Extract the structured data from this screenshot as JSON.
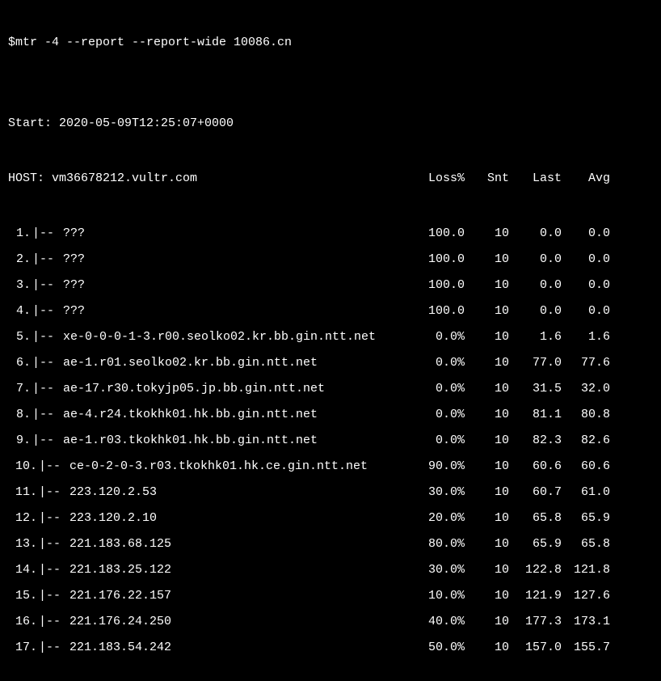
{
  "command": "$mtr -4 --report --report-wide 10086.cn",
  "start_line": "Start: 2020-05-09T12:25:07+0000",
  "host_line": "HOST: vm36678212.vultr.com",
  "headers": {
    "loss": "Loss%",
    "snt": "Snt",
    "last": "Last",
    "avg": "Avg"
  },
  "hops": [
    {
      "num": "1.",
      "tree": "|--",
      "host": "???",
      "loss": "100.0",
      "snt": "10",
      "last": "0.0",
      "avg": "0.0"
    },
    {
      "num": "2.",
      "tree": "|--",
      "host": "???",
      "loss": "100.0",
      "snt": "10",
      "last": "0.0",
      "avg": "0.0"
    },
    {
      "num": "3.",
      "tree": "|--",
      "host": "???",
      "loss": "100.0",
      "snt": "10",
      "last": "0.0",
      "avg": "0.0"
    },
    {
      "num": "4.",
      "tree": "|--",
      "host": "???",
      "loss": "100.0",
      "snt": "10",
      "last": "0.0",
      "avg": "0.0"
    },
    {
      "num": "5.",
      "tree": "|--",
      "host": "xe-0-0-0-1-3.r00.seolko02.kr.bb.gin.ntt.net",
      "loss": "0.0%",
      "snt": "10",
      "last": "1.6",
      "avg": "1.6"
    },
    {
      "num": "6.",
      "tree": "|--",
      "host": "ae-1.r01.seolko02.kr.bb.gin.ntt.net",
      "loss": "0.0%",
      "snt": "10",
      "last": "77.0",
      "avg": "77.6"
    },
    {
      "num": "7.",
      "tree": "|--",
      "host": "ae-17.r30.tokyjp05.jp.bb.gin.ntt.net",
      "loss": "0.0%",
      "snt": "10",
      "last": "31.5",
      "avg": "32.0"
    },
    {
      "num": "8.",
      "tree": "|--",
      "host": "ae-4.r24.tkokhk01.hk.bb.gin.ntt.net",
      "loss": "0.0%",
      "snt": "10",
      "last": "81.1",
      "avg": "80.8"
    },
    {
      "num": "9.",
      "tree": "|--",
      "host": "ae-1.r03.tkokhk01.hk.bb.gin.ntt.net",
      "loss": "0.0%",
      "snt": "10",
      "last": "82.3",
      "avg": "82.6"
    },
    {
      "num": "10.",
      "tree": "|--",
      "host": "ce-0-2-0-3.r03.tkokhk01.hk.ce.gin.ntt.net",
      "loss": "90.0%",
      "snt": "10",
      "last": "60.6",
      "avg": "60.6"
    },
    {
      "num": "11.",
      "tree": "|--",
      "host": "223.120.2.53",
      "loss": "30.0%",
      "snt": "10",
      "last": "60.7",
      "avg": "61.0"
    },
    {
      "num": "12.",
      "tree": "|--",
      "host": "223.120.2.10",
      "loss": "20.0%",
      "snt": "10",
      "last": "65.8",
      "avg": "65.9"
    },
    {
      "num": "13.",
      "tree": "|--",
      "host": "221.183.68.125",
      "loss": "80.0%",
      "snt": "10",
      "last": "65.9",
      "avg": "65.8"
    },
    {
      "num": "14.",
      "tree": "|--",
      "host": "221.183.25.122",
      "loss": "30.0%",
      "snt": "10",
      "last": "122.8",
      "avg": "121.8"
    },
    {
      "num": "15.",
      "tree": "|--",
      "host": "221.176.22.157",
      "loss": "10.0%",
      "snt": "10",
      "last": "121.9",
      "avg": "127.6"
    },
    {
      "num": "16.",
      "tree": "|--",
      "host": "221.176.24.250",
      "loss": "40.0%",
      "snt": "10",
      "last": "177.3",
      "avg": "173.1"
    },
    {
      "num": "17.",
      "tree": "|--",
      "host": "221.183.54.242",
      "loss": "50.0%",
      "snt": "10",
      "last": "157.0",
      "avg": "155.7"
    }
  ]
}
